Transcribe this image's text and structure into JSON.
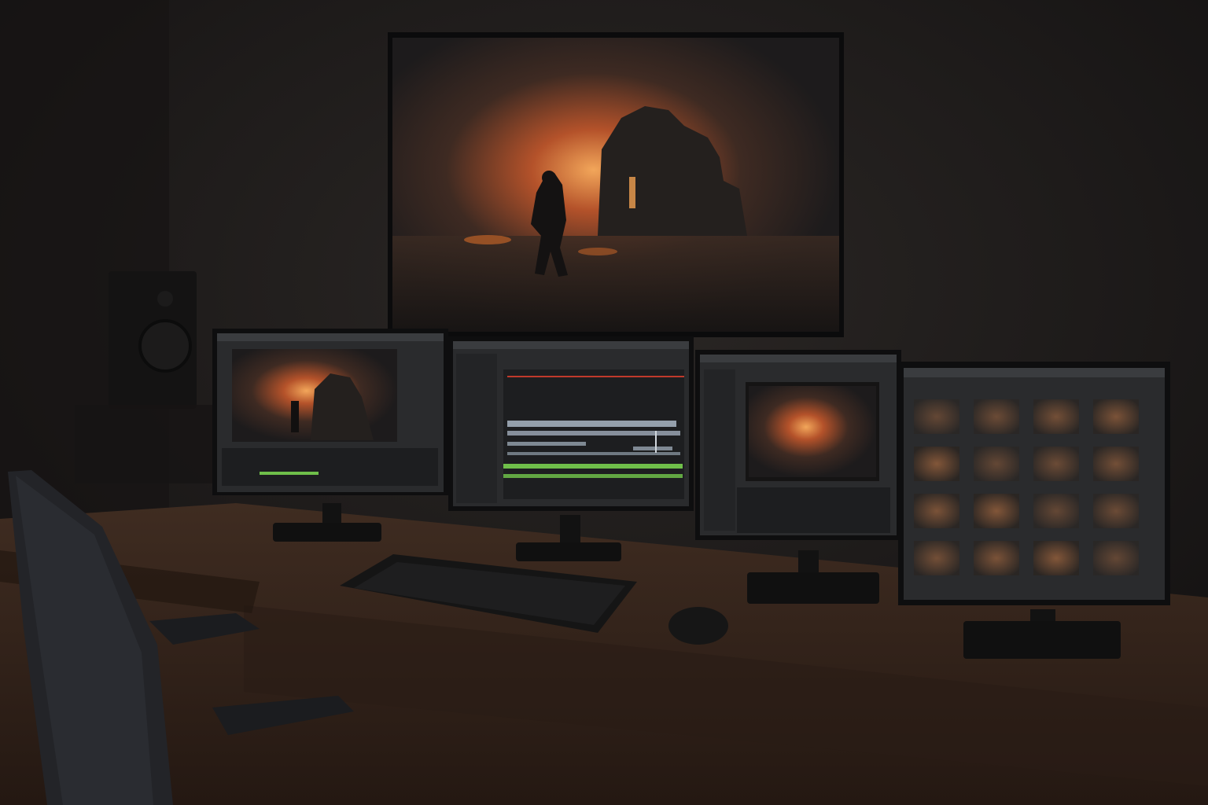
{
  "scene": {
    "palette": {
      "wall": "#1f1c1b",
      "desk": "#3b2a20",
      "desk_edge": "#2a1d16",
      "monitor_bezel": "#0e0e0f",
      "ui_panel": "#2a2b2d",
      "ui_dark": "#1d1e20",
      "accent_green": "#6fbf4a",
      "clip_blue": "#a9b6c4",
      "fire_orange": "#e07a2c",
      "playhead_red": "#c0392b"
    },
    "objects": {
      "wall_tv": "wall-mounted-display",
      "tv_image": "fiery-ruins-figure-scene",
      "monitor_1": "editing-viewer-monitor",
      "monitor_2": "timeline-monitor",
      "monitor_3": "preview-and-media-monitor",
      "monitor_4": "thumbnail-grid-monitor",
      "speaker": "studio-speaker",
      "keyboard": "keyboard",
      "mouse": "mouse",
      "chair": "office-chair",
      "desk": "wooden-desk"
    },
    "thumbnail_grid": {
      "rows": 4,
      "columns": 4
    }
  }
}
